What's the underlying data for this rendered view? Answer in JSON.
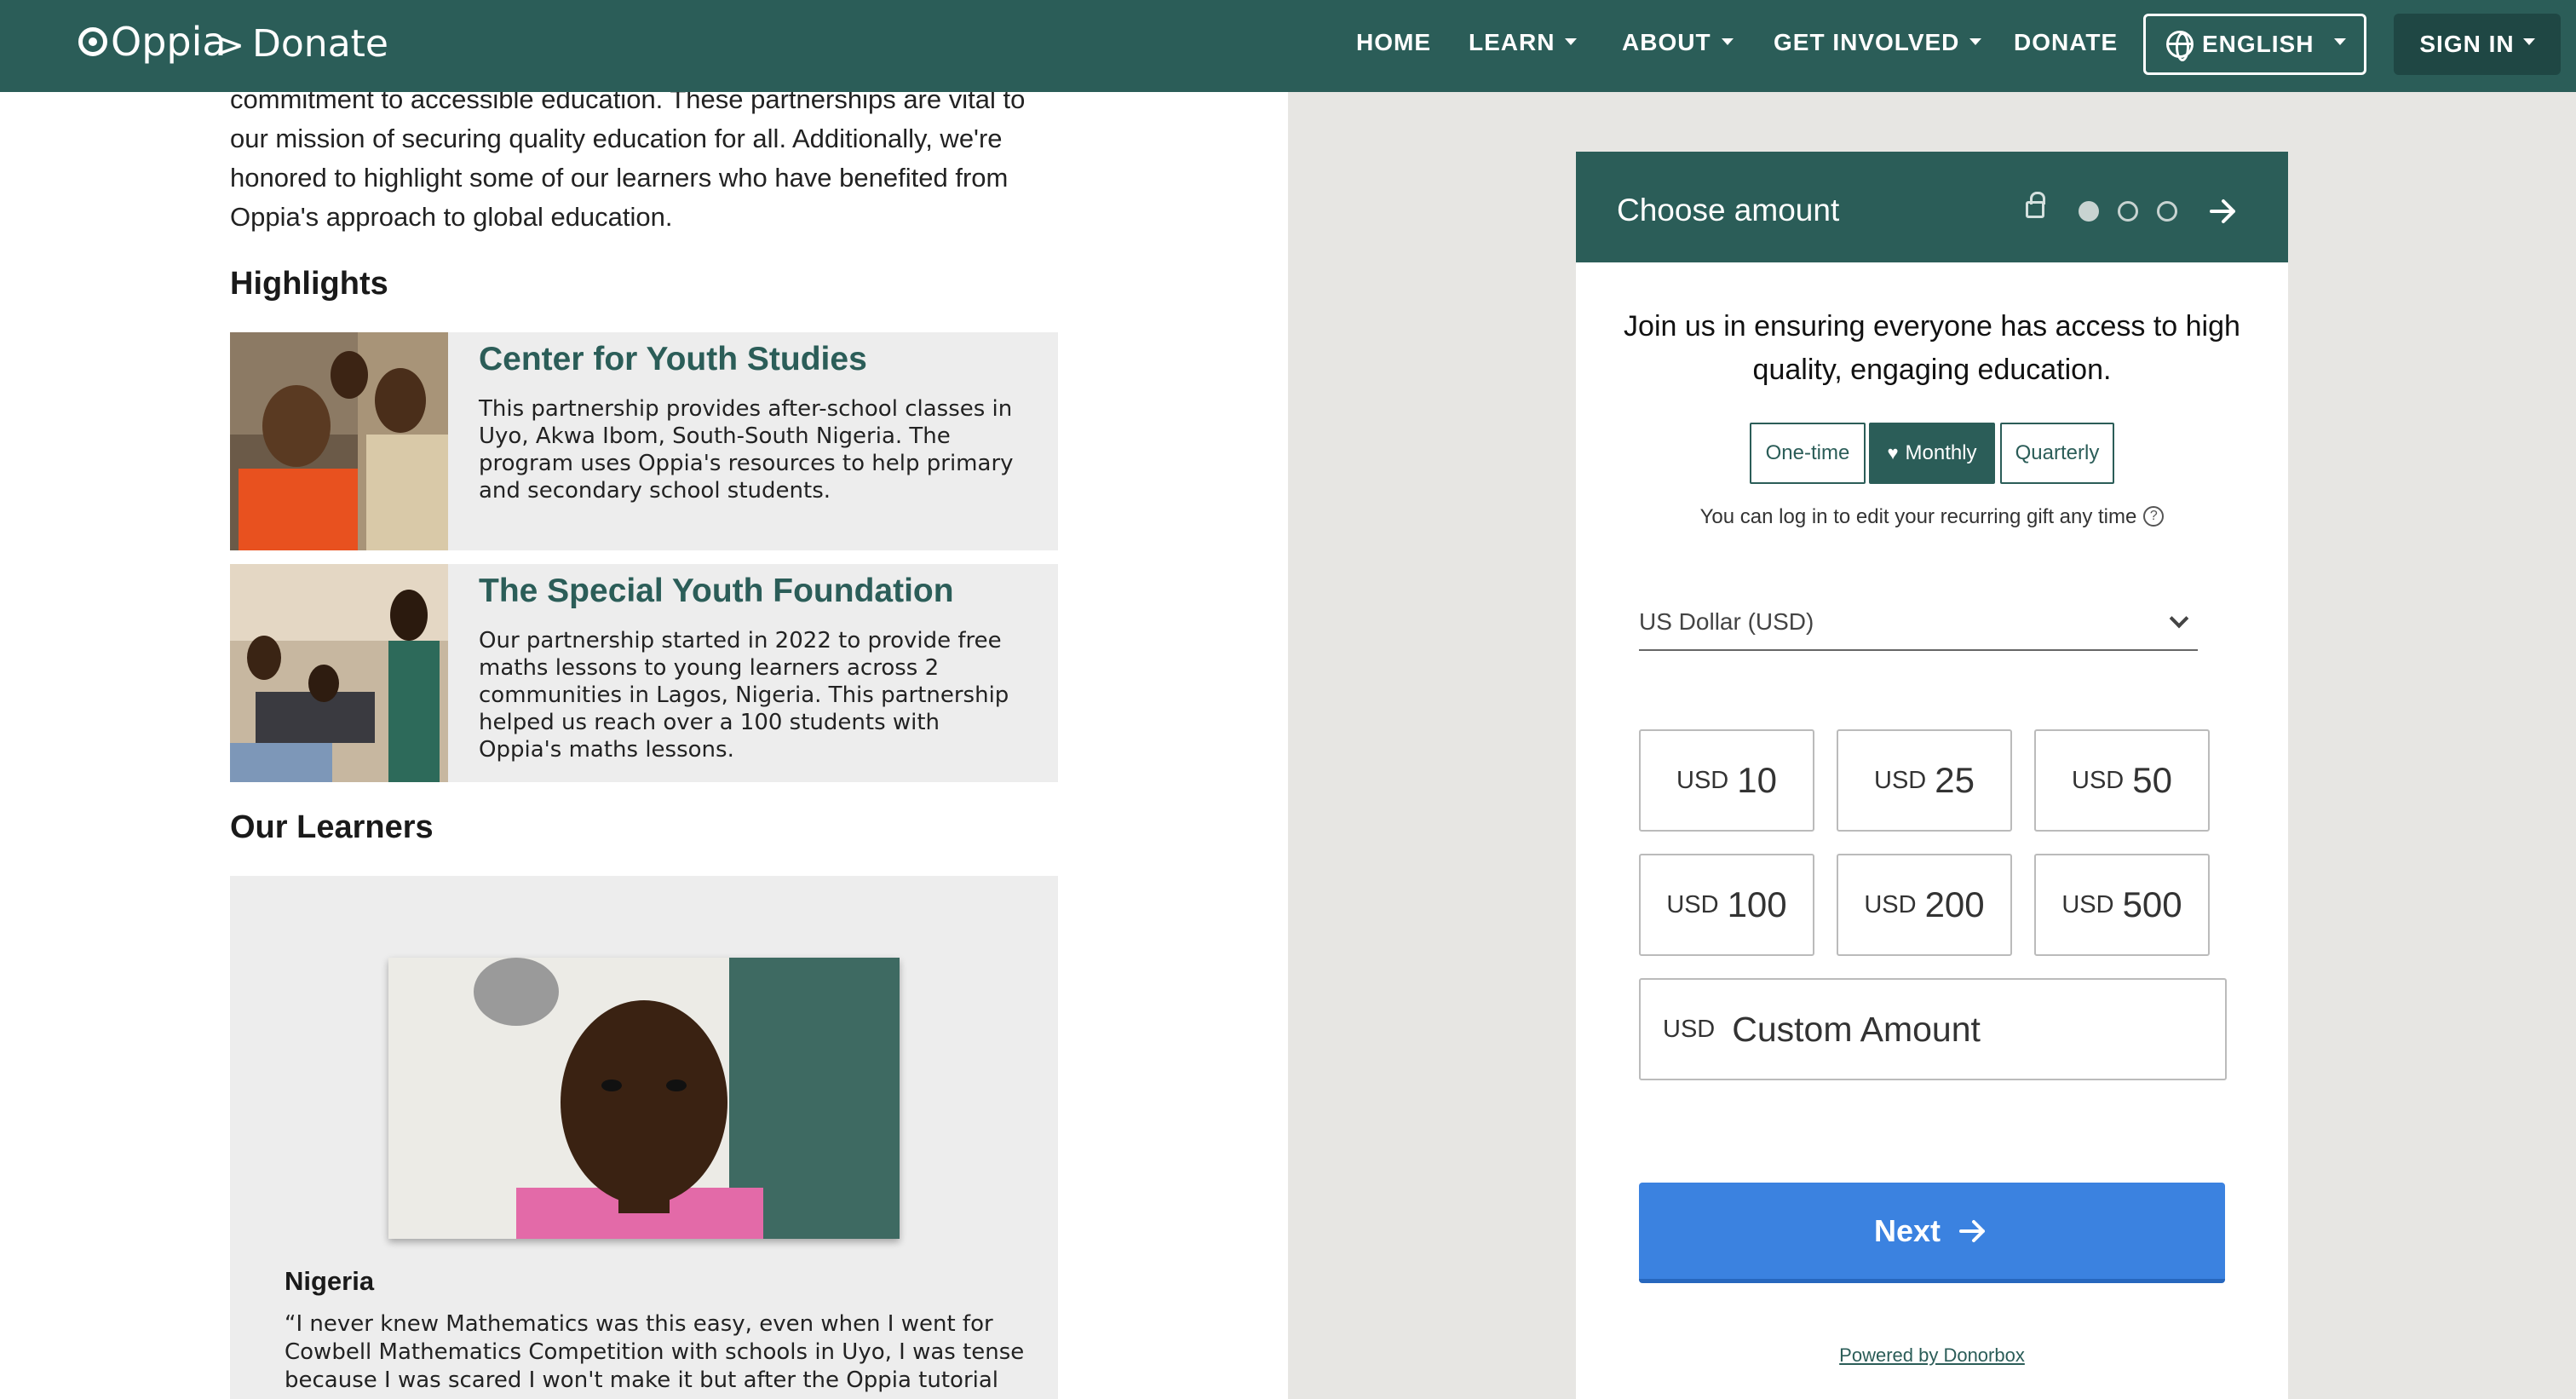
{
  "navbar": {
    "logo_text": "Oppia",
    "breadcrumb_sep": ">",
    "breadcrumb_page": "Donate",
    "items": [
      {
        "label": "HOME"
      },
      {
        "label": "LEARN"
      },
      {
        "label": "ABOUT"
      },
      {
        "label": "GET INVOLVED"
      },
      {
        "label": "DONATE"
      }
    ],
    "language": "ENGLISH",
    "sign_in": "SIGN IN"
  },
  "intro": {
    "text": "commitment to accessible education. These partnerships are vital to our mission of securing quality education for all. Additionally, we're honored to highlight some of our learners who have benefited from Oppia's approach to global education."
  },
  "highlights": {
    "title": "Highlights",
    "cards": [
      {
        "title": "Center for Youth Studies",
        "description": "This partnership provides after-school classes in Uyo, Akwa Ibom, South-South Nigeria. The program uses Oppia's resources to help primary and secondary school students."
      },
      {
        "title": "The Special Youth Foundation",
        "description": "Our partnership started in 2022 to provide free maths lessons to young learners across 2 communities in Lagos, Nigeria. This partnership helped us reach over a 100 students with Oppia's maths lessons."
      }
    ]
  },
  "learners": {
    "title": "Our Learners",
    "country": "Nigeria",
    "quote": "“I never knew Mathematics was this easy, even when I went for Cowbell Mathematics Competition with schools in Uyo, I was tense because I was scared I won't make it but after the Oppia tutorial"
  },
  "widget": {
    "title": "Choose amount",
    "lead": "Join us in ensuring everyone has access to high quality, engaging education.",
    "frequency": [
      {
        "label": "One-time",
        "active": false
      },
      {
        "label": "Monthly",
        "active": true
      },
      {
        "label": "Quarterly",
        "active": false
      }
    ],
    "note": "You can log in to edit your recurring gift any time",
    "currency": "US Dollar (USD)",
    "amounts": [
      {
        "currency": "USD",
        "value": "10"
      },
      {
        "currency": "USD",
        "value": "25"
      },
      {
        "currency": "USD",
        "value": "50"
      },
      {
        "currency": "USD",
        "value": "100"
      },
      {
        "currency": "USD",
        "value": "200"
      },
      {
        "currency": "USD",
        "value": "500"
      }
    ],
    "custom": {
      "currency": "USD",
      "placeholder": "Custom Amount"
    },
    "next": "Next",
    "powered_by": "Powered by Donorbox",
    "steps_total": 3,
    "step_current": 1
  },
  "colors": {
    "brand": "#2b5d58",
    "next_button": "#3b82e0",
    "page_gray": "#e7e6e3"
  }
}
